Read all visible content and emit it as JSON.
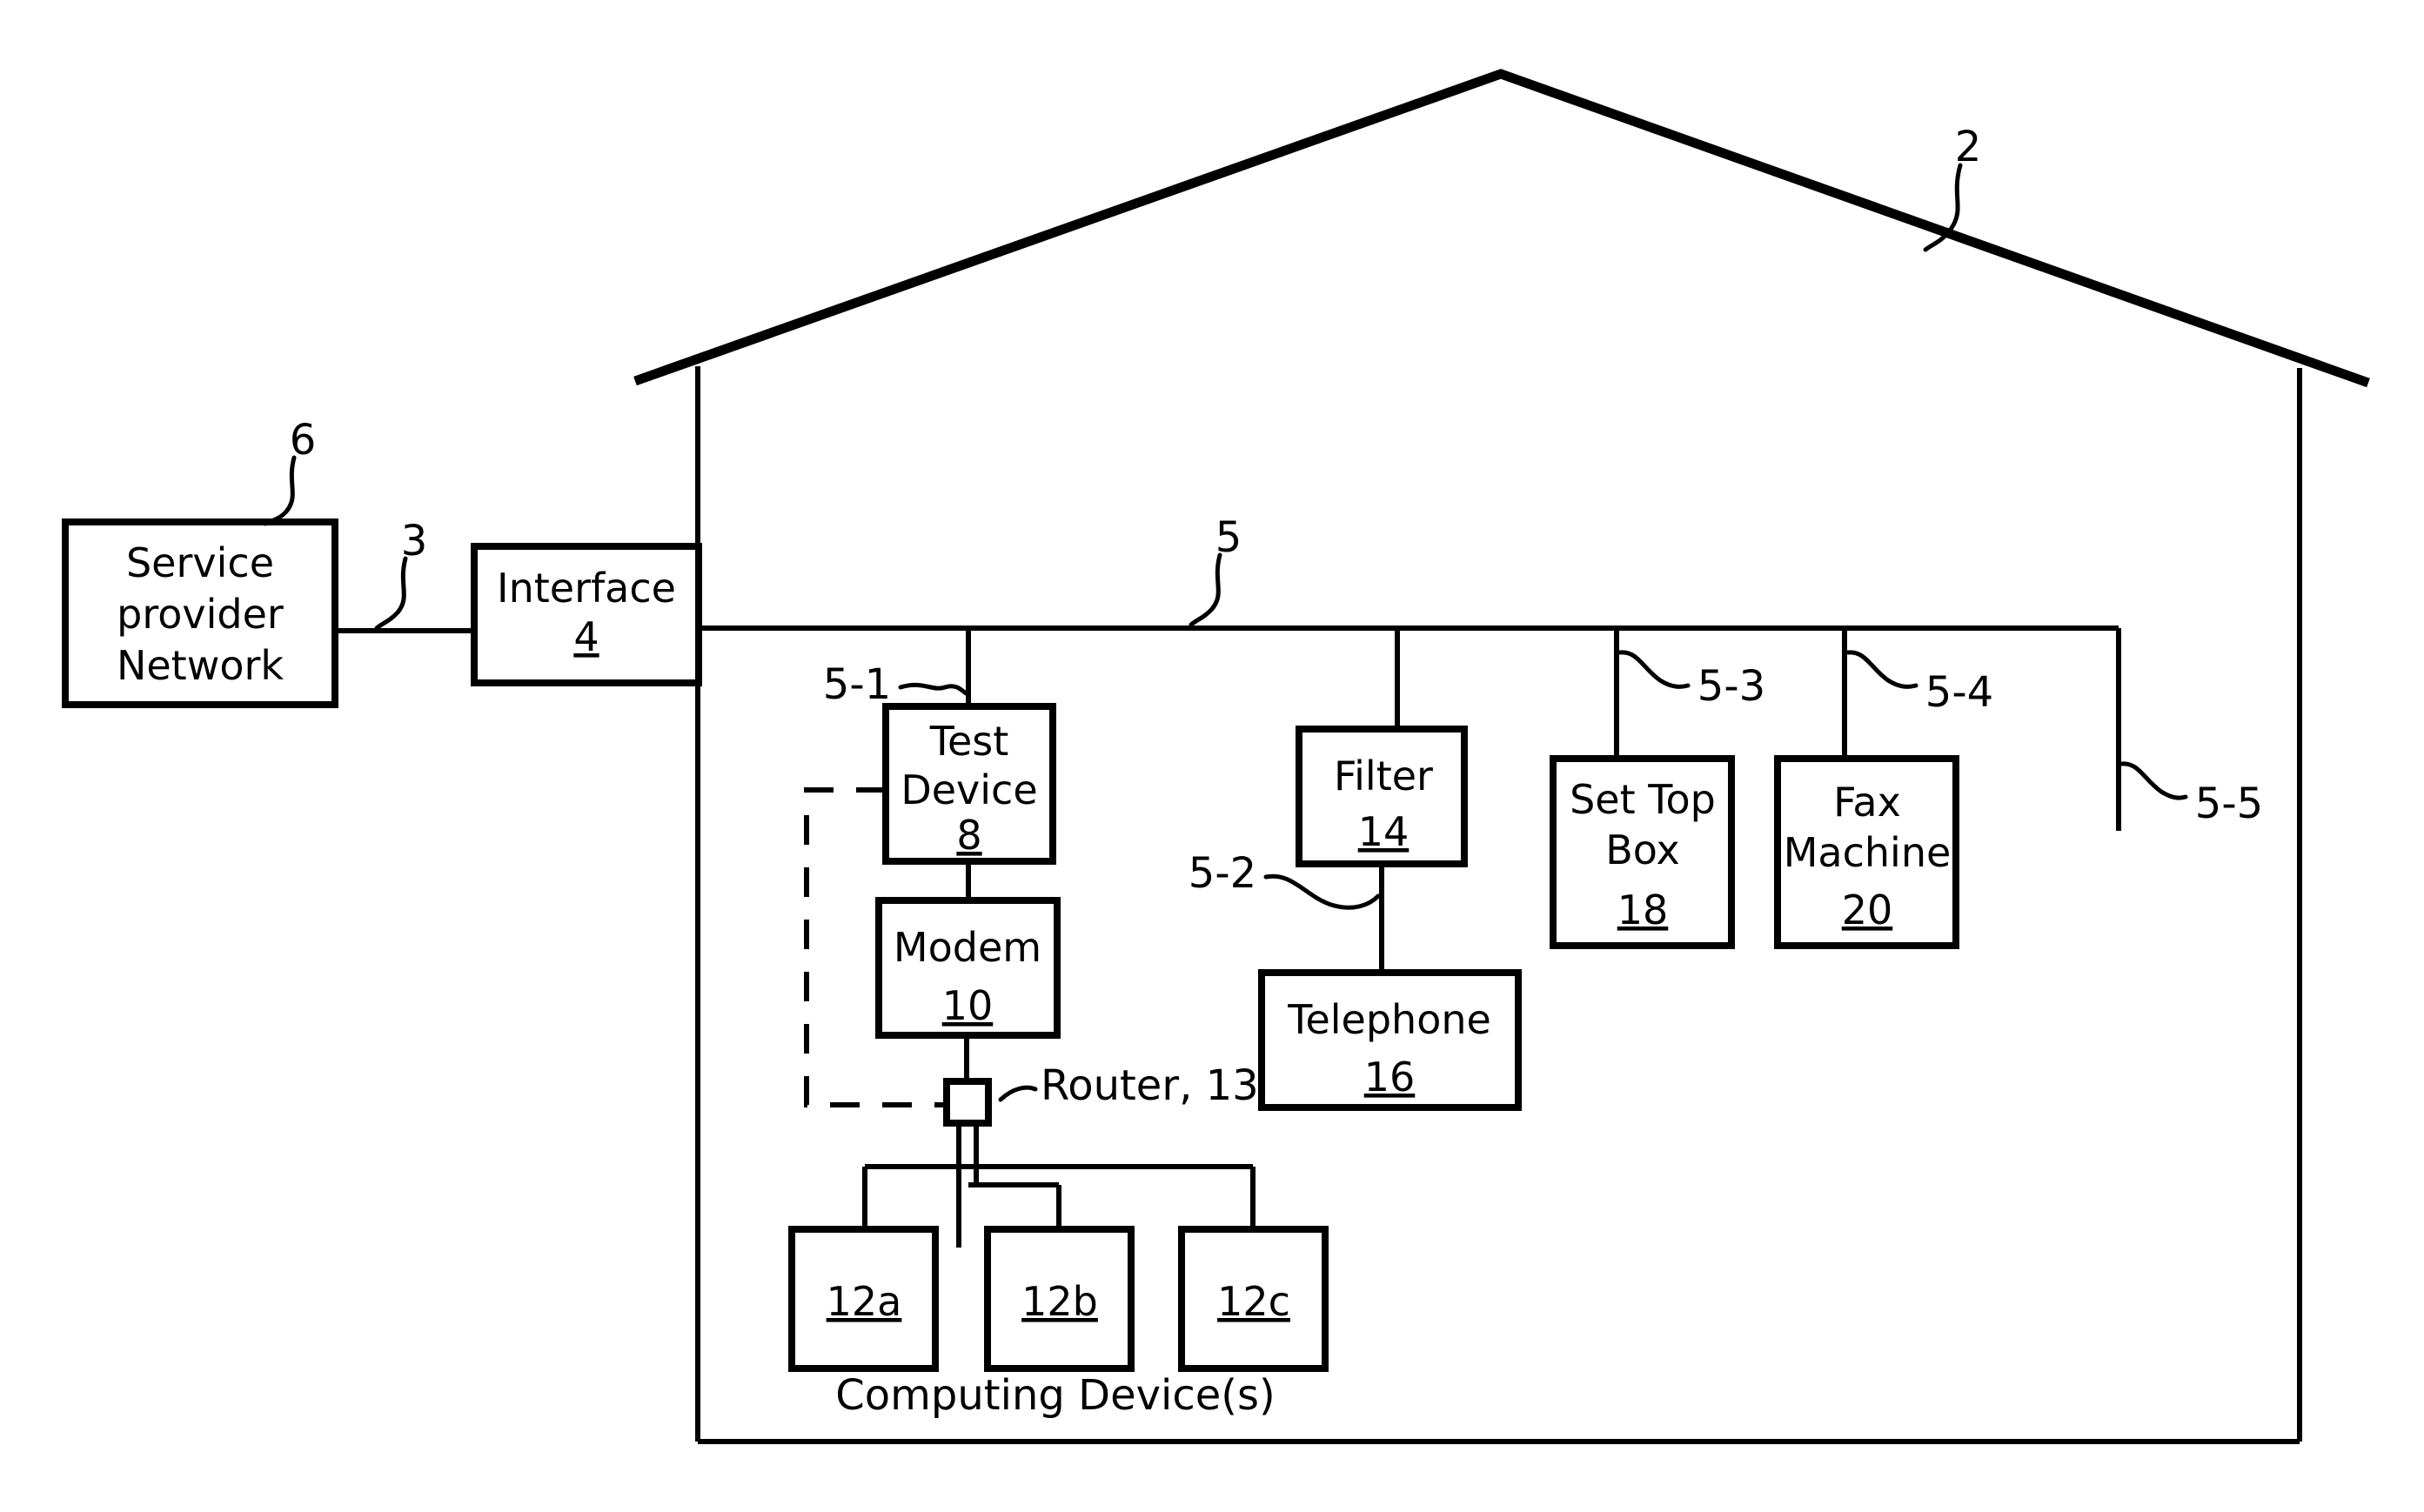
{
  "figure": {
    "title": "Home network patent diagram",
    "colors": {
      "ink": "#000000",
      "paper": "#ffffff"
    }
  },
  "reference_numerals": {
    "house": "2",
    "drop_line": "3",
    "service_provider_network": "6",
    "inside_wiring_bus": "5",
    "branch_test_device": "5-1",
    "branch_telephone": "5-2",
    "branch_set_top_box": "5-3",
    "branch_fax_machine": "5-4",
    "branch_spare": "5-5"
  },
  "boxes": {
    "service_provider_network": {
      "line1": "Service",
      "line2": "provider",
      "line3": "Network",
      "numeral": ""
    },
    "interface": {
      "line1": "Interface",
      "numeral": "4"
    },
    "test_device": {
      "line1": "Test",
      "line2": "Device",
      "numeral": "8"
    },
    "modem": {
      "line1": "Modem",
      "numeral": "10"
    },
    "filter": {
      "line1": "Filter",
      "numeral": "14"
    },
    "telephone": {
      "line1": "Telephone",
      "numeral": "16"
    },
    "set_top_box": {
      "line1": "Set Top",
      "line2": "Box",
      "numeral": "18"
    },
    "fax_machine": {
      "line1": "Fax",
      "line2": "Machine",
      "numeral": "20"
    },
    "computing_device_a": {
      "numeral": "12a"
    },
    "computing_device_b": {
      "numeral": "12b"
    },
    "computing_device_c": {
      "numeral": "12c"
    }
  },
  "labels": {
    "router": "Router, 13",
    "computing_devices_caption": "Computing Device(s)"
  }
}
